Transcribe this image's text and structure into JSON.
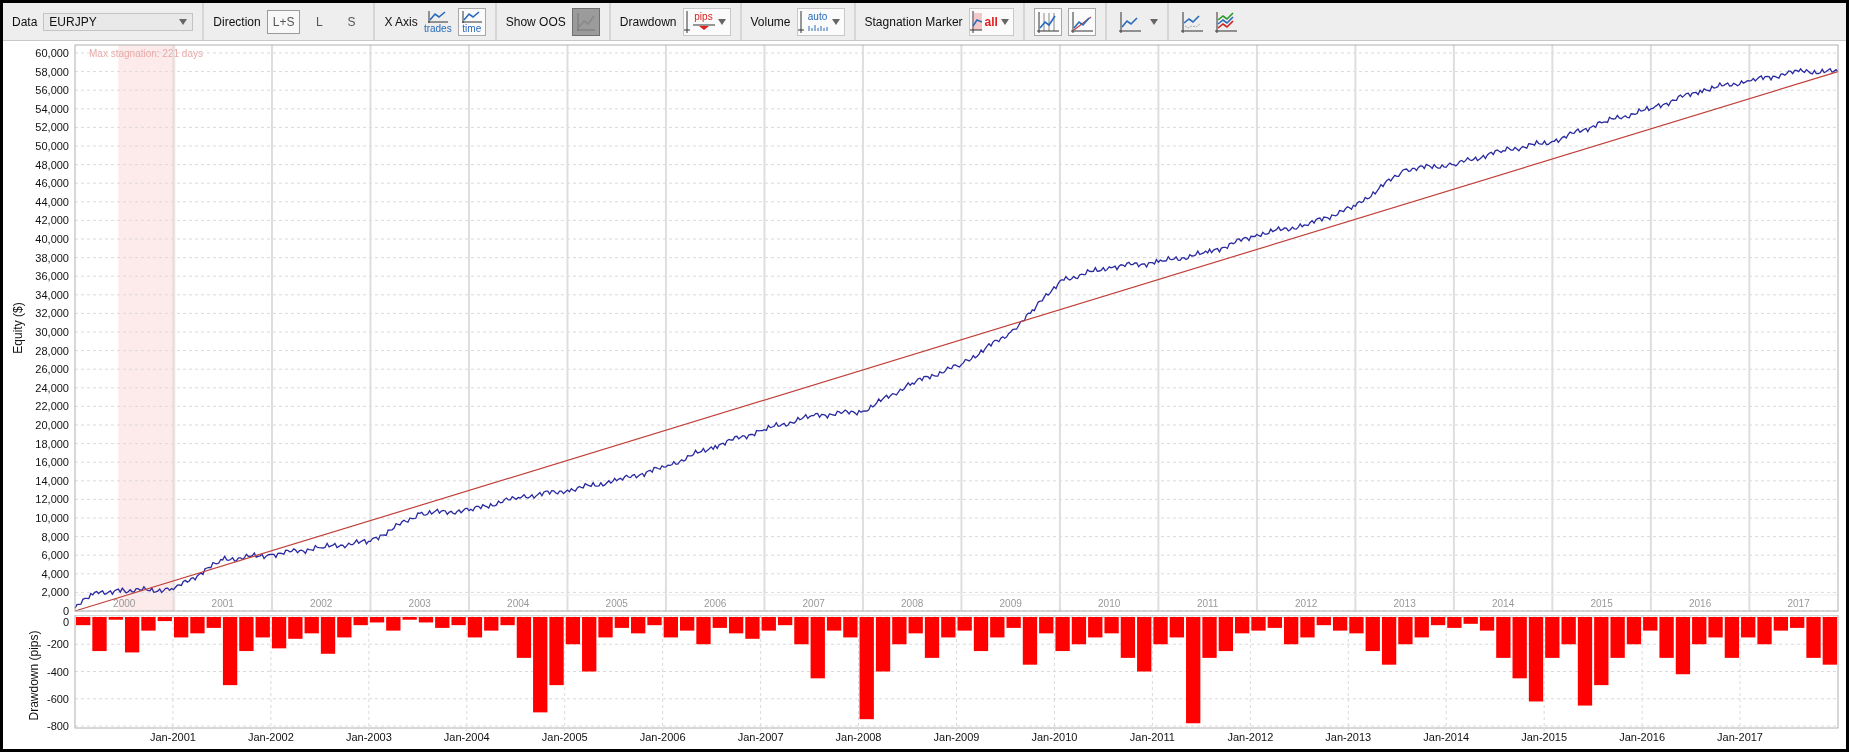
{
  "toolbar": {
    "data": {
      "label": "Data",
      "value": "EURJPY"
    },
    "direction": {
      "label": "Direction",
      "options": [
        {
          "label": "L+S",
          "selected": true
        },
        {
          "label": "L",
          "selected": false
        },
        {
          "label": "S",
          "selected": false
        }
      ]
    },
    "x_axis": {
      "label": "X Axis",
      "options": [
        {
          "caption": "trades",
          "selected": false
        },
        {
          "caption": "time",
          "selected": true
        }
      ]
    },
    "show_oos": {
      "label": "Show OOS",
      "on": true
    },
    "drawdown": {
      "label": "Drawdown",
      "caption": "pips"
    },
    "volume": {
      "label": "Volume",
      "caption": "auto"
    },
    "stagnation_marker": {
      "label": "Stagnation Marker",
      "caption": "all"
    },
    "chart_buttons": [
      {
        "kind": "grid",
        "selected": true
      },
      {
        "kind": "trend",
        "selected": true
      },
      {
        "kind": "line-menu",
        "selected": false
      },
      {
        "kind": "scatter",
        "selected": false
      },
      {
        "kind": "multi",
        "selected": false
      }
    ]
  },
  "equity_chart": {
    "chart_data": {
      "type": "line",
      "ylabel": "Equity ($)",
      "x": [
        1999.5,
        1999.7,
        2000,
        2000.5,
        2001,
        2001.5,
        2002,
        2002.5,
        2003,
        2003.5,
        2004,
        2004.5,
        2005,
        2005.5,
        2006,
        2006.5,
        2007,
        2007.5,
        2008,
        2008.5,
        2009,
        2009.2,
        2009.5,
        2010,
        2010.5,
        2011,
        2011.5,
        2012,
        2012.5,
        2013,
        2013.5,
        2014,
        2014.5,
        2015,
        2015.5,
        2016,
        2016.5,
        2017,
        2017.4
      ],
      "series": [
        {
          "color": "#2a2aa0",
          "values": [
            300,
            2000,
            2200,
            2300,
            5500,
            6100,
            6800,
            7500,
            10500,
            10800,
            12200,
            13000,
            14000,
            15500,
            17800,
            19500,
            21000,
            21500,
            24500,
            26500,
            30000,
            32000,
            35500,
            37000,
            37500,
            38500,
            40500,
            41500,
            43500,
            47500,
            48000,
            49500,
            50500,
            52500,
            54000,
            56000,
            57000,
            58000,
            58000
          ]
        },
        {
          "color": "#c0403a",
          "values": [
            0,
            null,
            null,
            null,
            null,
            null,
            null,
            null,
            null,
            null,
            null,
            null,
            null,
            null,
            null,
            null,
            null,
            null,
            null,
            null,
            null,
            null,
            null,
            null,
            null,
            null,
            null,
            null,
            null,
            null,
            null,
            null,
            null,
            null,
            null,
            null,
            null,
            null,
            58000
          ]
        }
      ],
      "xlim": [
        1999.5,
        2017.4
      ],
      "ylim": [
        0,
        60000
      ],
      "xticks": [
        2000,
        2001,
        2002,
        2003,
        2004,
        2005,
        2006,
        2007,
        2008,
        2009,
        2010,
        2011,
        2012,
        2013,
        2014,
        2015,
        2016,
        2017
      ],
      "yticks": [
        {
          "value": 0,
          "label": "0"
        },
        {
          "value": 2000,
          "label": "2,000"
        },
        {
          "value": 4000,
          "label": "4,000"
        },
        {
          "value": 6000,
          "label": "6,000"
        },
        {
          "value": 8000,
          "label": "8,000"
        },
        {
          "value": 10000,
          "label": "10,000"
        },
        {
          "value": 12000,
          "label": "12,000"
        },
        {
          "value": 14000,
          "label": "14,000"
        },
        {
          "value": 16000,
          "label": "16,000"
        },
        {
          "value": 18000,
          "label": "18,000"
        },
        {
          "value": 20000,
          "label": "20,000"
        },
        {
          "value": 22000,
          "label": "22,000"
        },
        {
          "value": 24000,
          "label": "24,000"
        },
        {
          "value": 26000,
          "label": "26,000"
        },
        {
          "value": 28000,
          "label": "28,000"
        },
        {
          "value": 30000,
          "label": "30,000"
        },
        {
          "value": 32000,
          "label": "32,000"
        },
        {
          "value": 34000,
          "label": "34,000"
        },
        {
          "value": 36000,
          "label": "36,000"
        },
        {
          "value": 38000,
          "label": "38,000"
        },
        {
          "value": 40000,
          "label": "40,000"
        },
        {
          "value": 42000,
          "label": "42,000"
        },
        {
          "value": 44000,
          "label": "44,000"
        },
        {
          "value": 46000,
          "label": "46,000"
        },
        {
          "value": 48000,
          "label": "48,000"
        },
        {
          "value": 50000,
          "label": "50,000"
        },
        {
          "value": 52000,
          "label": "52,000"
        },
        {
          "value": 54000,
          "label": "54,000"
        },
        {
          "value": 56000,
          "label": "56,000"
        },
        {
          "value": 58000,
          "label": "58,000"
        },
        {
          "value": 60000,
          "label": "60,000"
        }
      ],
      "grid": true,
      "bands": [
        {
          "axis": "x",
          "from": 1999.94,
          "to": 2000.52,
          "label": "Max stagnation: 221 days"
        }
      ]
    }
  },
  "drawdown_chart": {
    "chart_data": {
      "type": "bar",
      "ylabel": "Drawdown (pips)",
      "color": "#ff0000",
      "grid": true,
      "categories": [
        null,
        null,
        null,
        null,
        null,
        null,
        "Jan-2001",
        null,
        null,
        null,
        null,
        null,
        "Jan-2002",
        null,
        null,
        null,
        null,
        null,
        "Jan-2003",
        null,
        null,
        null,
        null,
        null,
        "Jan-2004",
        null,
        null,
        null,
        null,
        null,
        "Jan-2005",
        null,
        null,
        null,
        null,
        null,
        "Jan-2006",
        null,
        null,
        null,
        null,
        null,
        "Jan-2007",
        null,
        null,
        null,
        null,
        null,
        "Jan-2008",
        null,
        null,
        null,
        null,
        null,
        "Jan-2009",
        null,
        null,
        null,
        null,
        null,
        "Jan-2010",
        null,
        null,
        null,
        null,
        null,
        "Jan-2011",
        null,
        null,
        null,
        null,
        null,
        "Jan-2012",
        null,
        null,
        null,
        null,
        null,
        "Jan-2013",
        null,
        null,
        null,
        null,
        null,
        "Jan-2014",
        null,
        null,
        null,
        null,
        null,
        "Jan-2015",
        null,
        null,
        null,
        null,
        null,
        "Jan-2016",
        null,
        null,
        null,
        null,
        null,
        "Jan-2017",
        null,
        null,
        null,
        null,
        null
      ],
      "values": [
        -60,
        -250,
        -20,
        -260,
        -100,
        -30,
        -150,
        -120,
        -80,
        -500,
        -250,
        -150,
        -230,
        -160,
        -120,
        -270,
        -150,
        -60,
        -40,
        -100,
        -20,
        -40,
        -80,
        -60,
        -150,
        -100,
        -60,
        -300,
        -700,
        -500,
        -200,
        -400,
        -150,
        -80,
        -120,
        -60,
        -150,
        -100,
        -200,
        -80,
        -120,
        -160,
        -100,
        -60,
        -200,
        -450,
        -100,
        -150,
        -750,
        -400,
        -200,
        -120,
        -300,
        -150,
        -100,
        -250,
        -150,
        -80,
        -350,
        -120,
        -250,
        -200,
        -150,
        -120,
        -300,
        -400,
        -200,
        -150,
        -780,
        -300,
        -250,
        -120,
        -100,
        -80,
        -200,
        -150,
        -60,
        -100,
        -120,
        -250,
        -350,
        -200,
        -150,
        -60,
        -80,
        -50,
        -100,
        -300,
        -450,
        -620,
        -300,
        -200,
        -650,
        -500,
        -300,
        -200,
        -100,
        -300,
        -420,
        -200,
        -150,
        -300,
        -150,
        -200,
        -100,
        -80,
        -300,
        -350
      ],
      "ylim": [
        -800,
        0
      ],
      "yticks": [
        {
          "value": 0,
          "label": "0"
        },
        {
          "value": -200,
          "label": "-200"
        },
        {
          "value": -400,
          "label": "-400"
        },
        {
          "value": -600,
          "label": "-600"
        },
        {
          "value": -800,
          "label": "-800"
        }
      ]
    }
  }
}
